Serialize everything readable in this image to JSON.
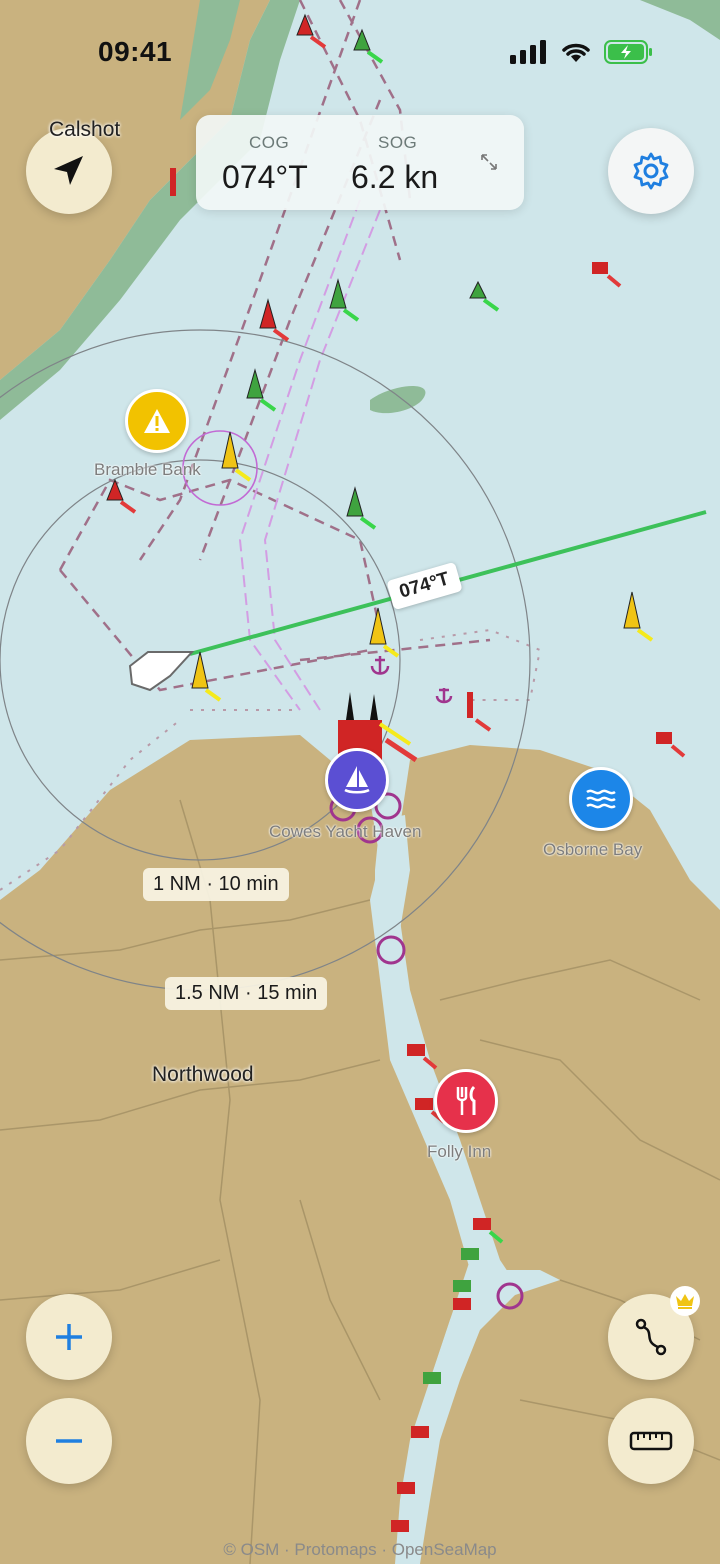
{
  "status_bar": {
    "time": "09:41"
  },
  "hud": {
    "cog_label": "COG",
    "cog_value": "074°T",
    "sog_label": "SOG",
    "sog_value": "6.2 kn"
  },
  "map": {
    "course_label": "074°T",
    "range_rings": [
      "1 NM · 10 min",
      "1.5 NM · 15 min"
    ],
    "places": {
      "calshot": "Calshot",
      "bramble_bank": "Bramble Bank",
      "cowes": "Cowes Yacht Haven",
      "osborne": "Osborne Bay",
      "northwood": "Northwood",
      "folly": "Folly Inn"
    },
    "attribution": "© OSM · Protomaps · OpenSeaMap"
  },
  "icons": {
    "locate": "navigation-arrow-icon",
    "settings": "gear-icon",
    "expand": "expand-icon",
    "route": "route-icon",
    "ruler": "ruler-icon",
    "premium": "crown-icon",
    "zoom_in": "plus-icon",
    "zoom_out": "minus-icon"
  },
  "colors": {
    "water": "#cfe6ea",
    "land": "#c9b27f",
    "course_line": "#3dc15a",
    "accent": "#1f7fe0",
    "hazard": "#f2c200",
    "marina": "#5b4fd3",
    "restaurant": "#e6314b",
    "anchorage": "#1c86e8"
  }
}
